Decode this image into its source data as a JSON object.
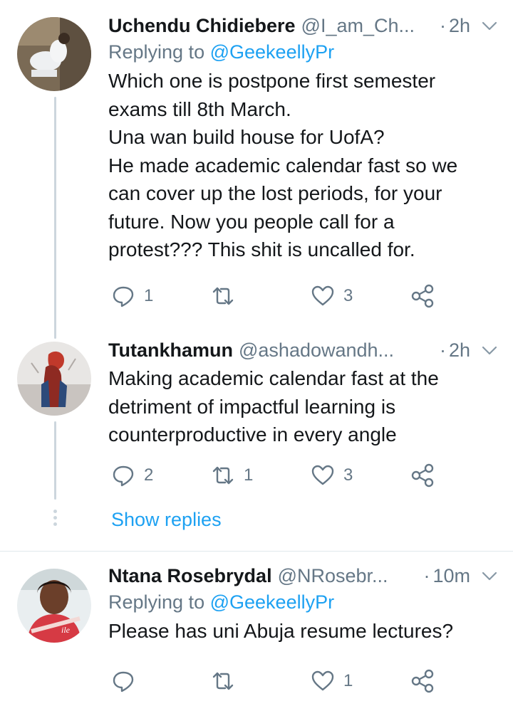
{
  "tweets": [
    {
      "name": "Uchendu Chidiebere",
      "handle": "@I_am_Ch...",
      "time": "2h",
      "replying_label": "Replying to",
      "replying_to": "@GeekeellyPr",
      "text": "Which one is postpone first semester\nexams till 8th March.\nUna wan build house for UofA?\nHe made academic calendar fast so we\ncan cover up the lost periods, for your\nfuture. Now you people call for a\nprotest??? This shit is uncalled for.",
      "replies": "1",
      "retweets": "",
      "likes": "3"
    },
    {
      "name": "Tutankhamun",
      "handle": "@ashadowandh...",
      "time": "2h",
      "text": "Making academic calendar fast at the\ndetriment of impactful learning is\ncounterproductive in every angle",
      "replies": "2",
      "retweets": "1",
      "likes": "3"
    },
    {
      "name": "Ntana Rosebrydal",
      "handle": "@NRosebr...",
      "time": "10m",
      "replying_label": "Replying to",
      "replying_to": "@GeekeellyPr",
      "text": "Please has uni Abuja resume lectures?",
      "replies": "",
      "retweets": "",
      "likes": "1"
    }
  ],
  "show_replies": "Show replies",
  "icons": {
    "reply": "reply-icon",
    "retweet": "retweet-icon",
    "like": "heart-icon",
    "share": "share-icon",
    "menu": "chevron-down-icon"
  },
  "colors": {
    "text": "#14171a",
    "secondary": "#657786",
    "accent": "#1da1f2",
    "thread_line": "#ccd6dd"
  }
}
